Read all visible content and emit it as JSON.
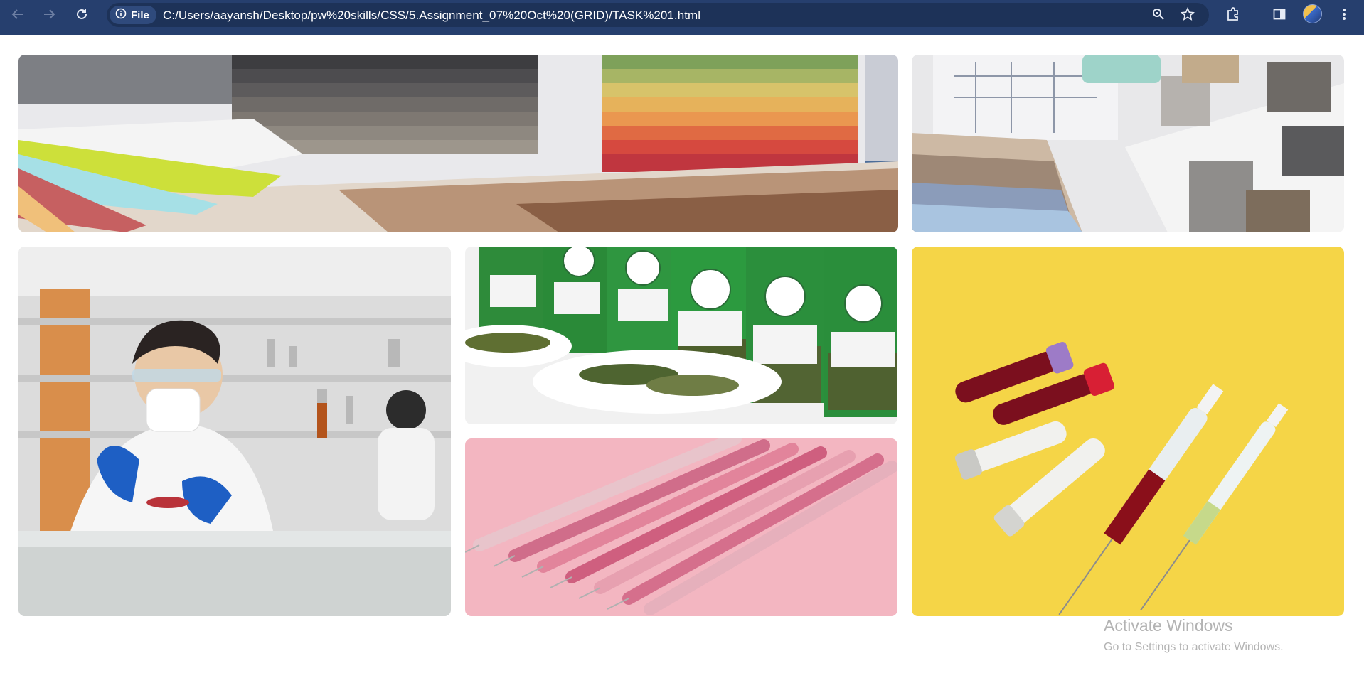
{
  "browser": {
    "url_chip_label": "File",
    "url": "C:/Users/aayansh/Desktop/pw%20skills/CSS/5.Assignment_07%20Oct%20(GRID)/TASK%201.html"
  },
  "icons": [
    "back-arrow-icon",
    "forward-arrow-icon",
    "reload-icon",
    "info-icon",
    "zoom-icon",
    "star-icon",
    "extensions-icon",
    "sidebar-icon",
    "profile-avatar",
    "menu-dots-icon"
  ],
  "colors": {
    "toolbar": "#263f6e",
    "omnibox": "#1d3258",
    "page_background": "#ffffff",
    "yellow_background": "#f5d547",
    "pink_background": "#f3b6c1"
  },
  "grid": {
    "tiles": [
      {
        "name": "fabric-color-swatches-image"
      },
      {
        "name": "interior-material-samples-image"
      },
      {
        "name": "laboratory-scientist-image"
      },
      {
        "name": "spice-jars-image"
      },
      {
        "name": "pink-syringes-image"
      },
      {
        "name": "blood-vials-syringes-image"
      }
    ]
  },
  "watermark": {
    "title": "Activate Windows",
    "subtitle": "Go to Settings to activate Windows."
  }
}
